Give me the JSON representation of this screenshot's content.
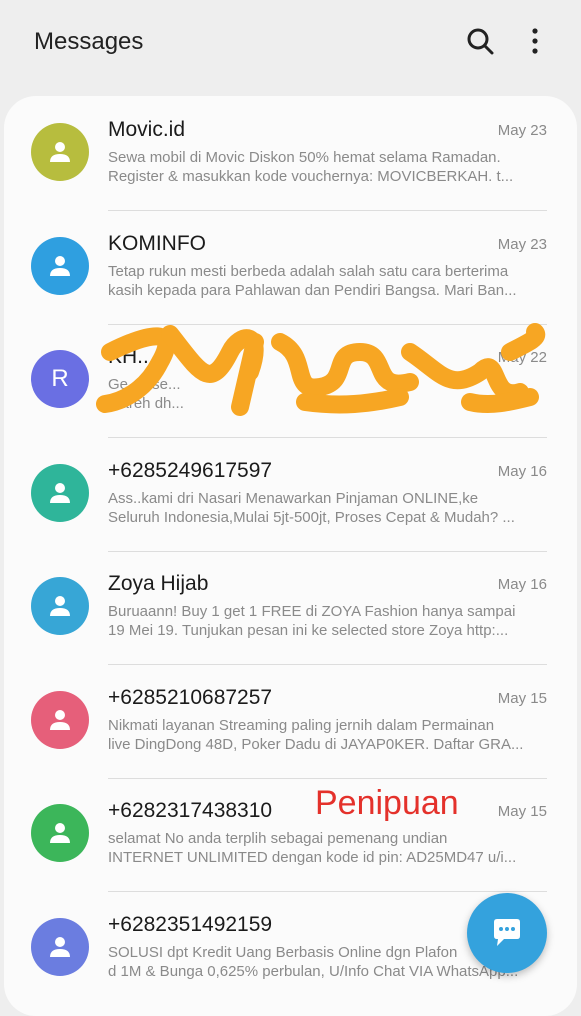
{
  "header": {
    "title": "Messages",
    "icons": [
      "search-icon",
      "more-vert-icon"
    ]
  },
  "conversations": [
    {
      "name": "Movic.id",
      "date": "May 23",
      "preview_line1": "Sewa mobil di Movic Diskon 50% hemat selama Ramadan.",
      "preview_line2": "Register & masukkan kode vouchernya: MOVICBERKAH.  t...",
      "avatar_color": "#b7bd3e",
      "avatar_letter": ""
    },
    {
      "name": "KOMINFO",
      "date": "May 23",
      "preview_line1": "Tetap rukun mesti berbeda adalah salah satu cara berterima",
      "preview_line2": "kasih kepada para Pahlawan dan Pendiri Bangsa. Mari Ban...",
      "avatar_color": "#2f9fe0",
      "avatar_letter": ""
    },
    {
      "name": "KH...",
      "date": "May 22",
      "preview_line1": "Ge...k se...",
      "preview_line2": "...areh dh...",
      "avatar_color": "#6a6fe3",
      "avatar_letter": "R"
    },
    {
      "name": "+6285249617597",
      "date": "May 16",
      "preview_line1": "Ass..kami dri Nasari Menawarkan Pinjaman ONLINE,ke",
      "preview_line2": "Seluruh Indonesia,Mulai 5jt-500jt, Proses Cepat & Mudah? ...",
      "avatar_color": "#2fb59a",
      "avatar_letter": ""
    },
    {
      "name": "Zoya Hijab",
      "date": "May 16",
      "preview_line1": "Buruaann! Buy 1 get 1 FREE di ZOYA Fashion hanya sampai",
      "preview_line2": "19 Mei 19. Tunjukan pesan ini ke selected store Zoya http:...",
      "avatar_color": "#37a6d6",
      "avatar_letter": ""
    },
    {
      "name": "+6285210687257",
      "date": "May 15",
      "preview_line1": "Nikmati layanan Streaming paling jernih dalam Permainan",
      "preview_line2": "live DingDong 48D, Poker Dadu di JAYAP0KER. Daftar GRA...",
      "avatar_color": "#e65f7a",
      "avatar_letter": ""
    },
    {
      "name": "+6282317438310",
      "date": "May 15",
      "preview_line1": "selamat No anda terplih sebagai pemenang undian",
      "preview_line2": "INTERNET UNLIMITED dengan kode id pin: AD25MD47 u/i...",
      "avatar_color": "#3cb65a",
      "avatar_letter": ""
    },
    {
      "name": "+6282351492159",
      "date": "",
      "preview_line1": "SOLUSI dpt Kredit Uang Berbasis Online dgn Plafon",
      "preview_line2": "d 1M & Bunga 0,625% perbulan, U/Info Chat VIA WhatsApp...",
      "avatar_color": "#6b7de0",
      "avatar_letter": ""
    }
  ],
  "annotation": {
    "text": "Penipuan",
    "color": "#e4312b"
  },
  "fab": {
    "icon": "compose-message-icon",
    "color": "#34a2dd"
  }
}
